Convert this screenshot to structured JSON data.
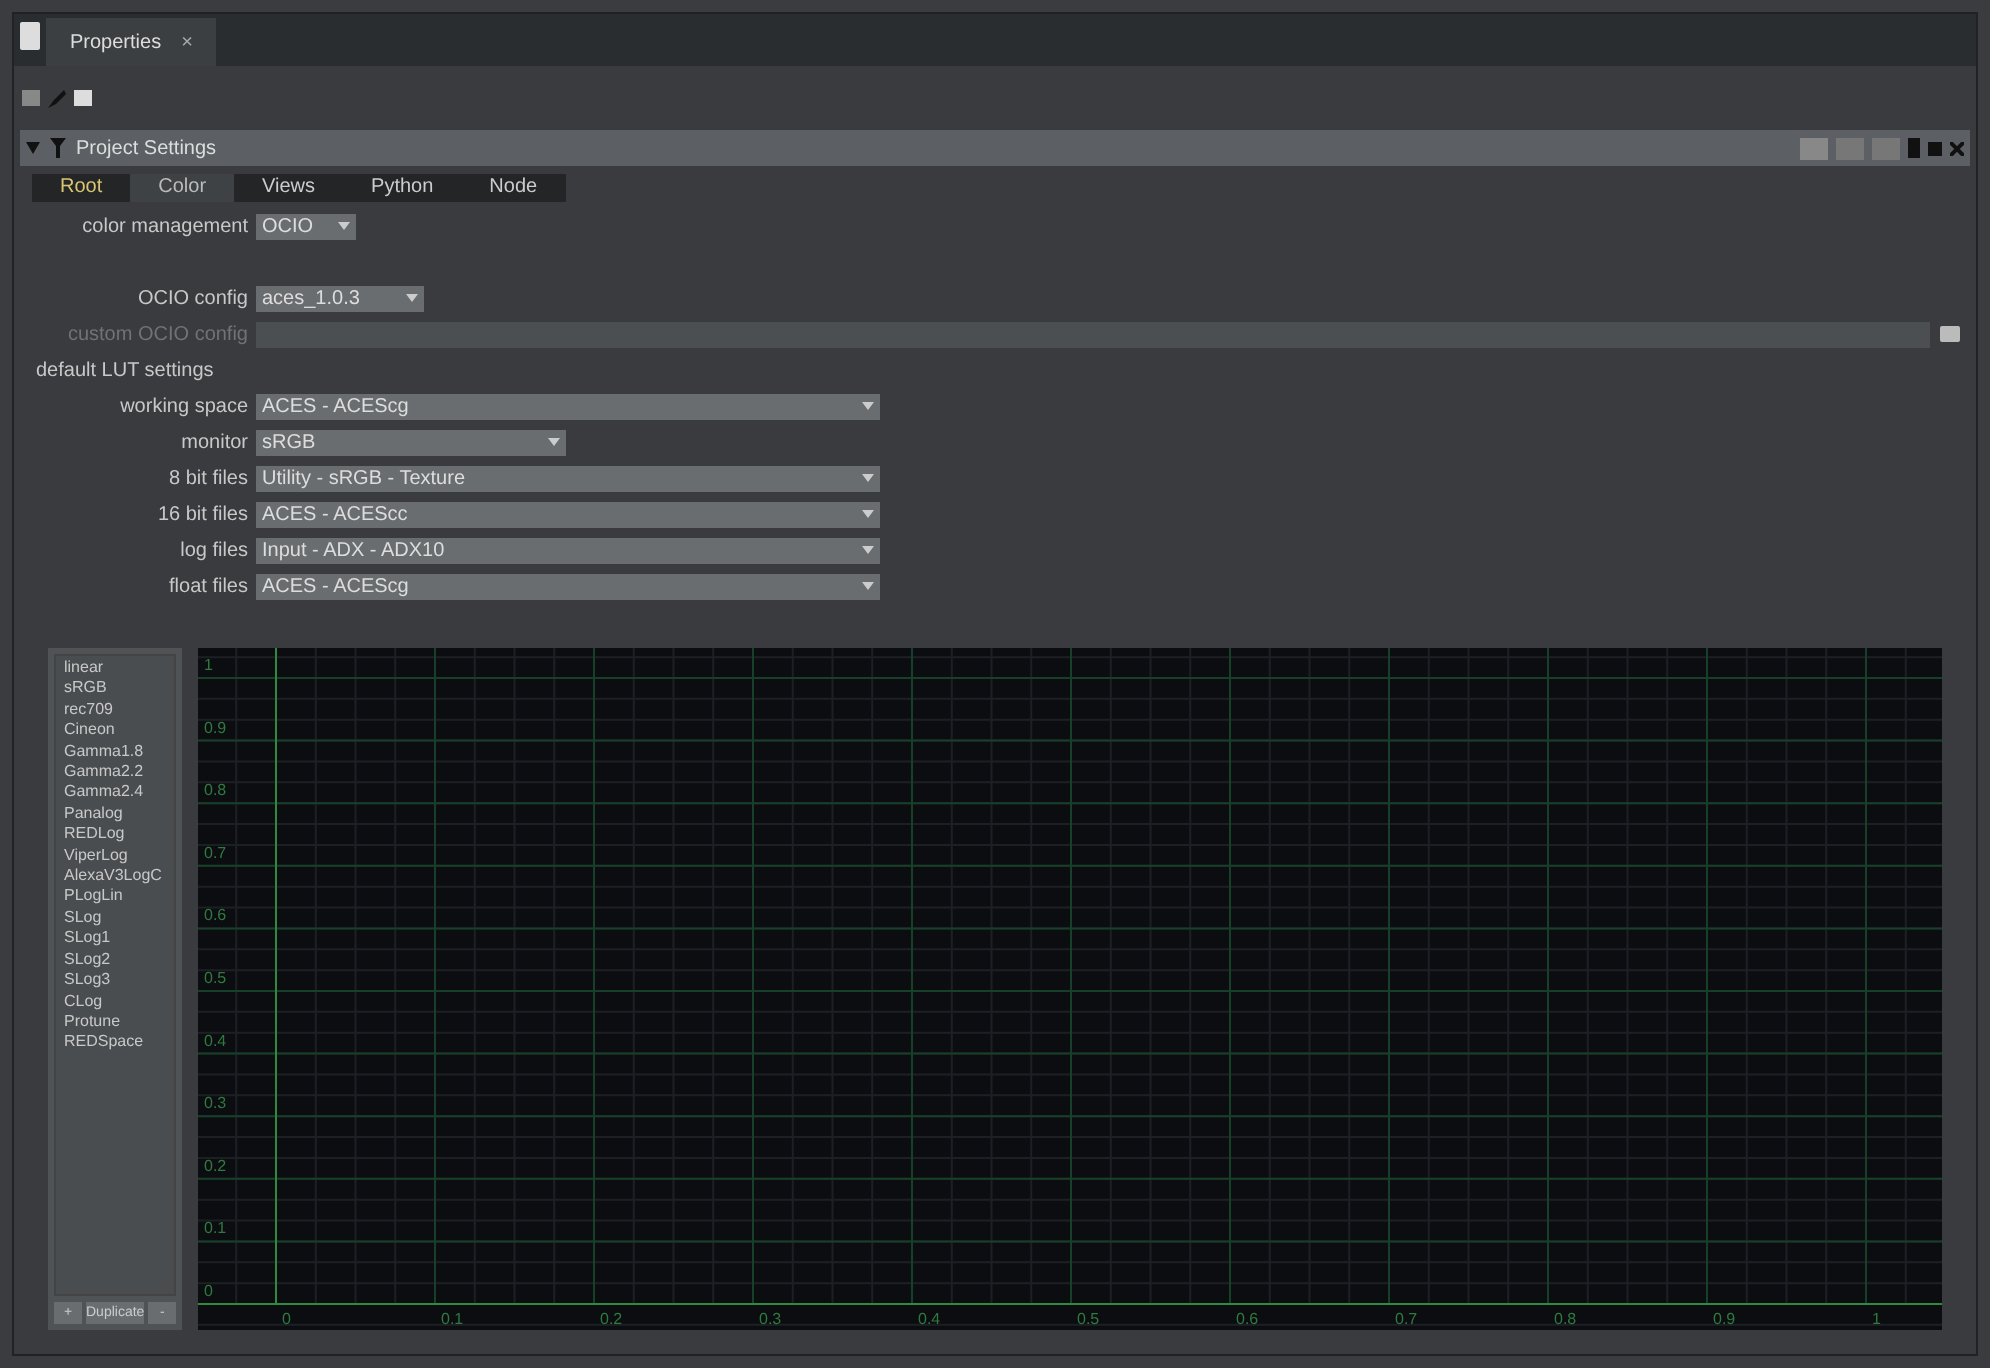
{
  "panel_tab": {
    "label": "Properties",
    "close": "×"
  },
  "node": {
    "title": "Project Settings",
    "expanded": true
  },
  "tabs": [
    {
      "label": "Root",
      "selected": false
    },
    {
      "label": "Color",
      "selected": true
    },
    {
      "label": "Views",
      "selected": false
    },
    {
      "label": "Python",
      "selected": false
    },
    {
      "label": "Node",
      "selected": false
    }
  ],
  "color_management": {
    "label": "color management",
    "value": "OCIO"
  },
  "ocio_config": {
    "label": "OCIO config",
    "value": "aces_1.0.3"
  },
  "custom_ocio_config": {
    "label": "custom OCIO config",
    "disabled": true
  },
  "section": "default LUT settings",
  "lut_settings": [
    {
      "label": "working space",
      "value": "ACES - ACEScg",
      "wide": true
    },
    {
      "label": "monitor",
      "value": "sRGB",
      "wide": false
    },
    {
      "label": "8 bit files",
      "value": "Utility - sRGB - Texture",
      "wide": true
    },
    {
      "label": "16 bit files",
      "value": "ACES - ACEScc",
      "wide": true
    },
    {
      "label": "log files",
      "value": "Input - ADX - ADX10",
      "wide": true
    },
    {
      "label": "float files",
      "value": "ACES - ACEScg",
      "wide": true
    }
  ],
  "lut_list": [
    "linear",
    "sRGB",
    "rec709",
    "Cineon",
    "Gamma1.8",
    "Gamma2.2",
    "Gamma2.4",
    "Panalog",
    "REDLog",
    "ViperLog",
    "AlexaV3LogC",
    "PLogLin",
    "SLog",
    "SLog1",
    "SLog2",
    "SLog3",
    "CLog",
    "Protune",
    "REDSpace"
  ],
  "list_buttons": [
    "+",
    "Duplicate",
    "-"
  ],
  "curve_editor": {
    "x_labels": [
      "0",
      "0.1",
      "0.2",
      "0.3",
      "0.4",
      "0.5",
      "0.6",
      "0.7",
      "0.8",
      "0.9",
      "1"
    ],
    "y_labels": [
      "1",
      "0.9",
      "0.8",
      "0.7",
      "0.6",
      "0.5",
      "0.4",
      "0.3",
      "0.2",
      "0.1",
      "0"
    ]
  }
}
